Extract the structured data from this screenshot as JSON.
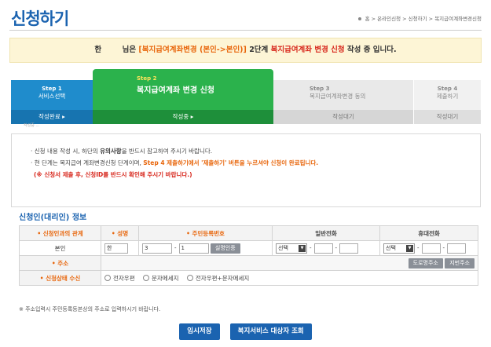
{
  "page": {
    "title": "신청하기",
    "breadcrumb": [
      "홈",
      "온라인신청",
      "신청하기",
      "복지급여계좌변경신청"
    ]
  },
  "notice": {
    "user": "한",
    "mid": "님은",
    "service": "[복지급여계좌변경 (본인->본인)]",
    "pre": "2단계",
    "step": "복지급여계좌 변경 신청",
    "post": "작성 중 입니다."
  },
  "steps": [
    {
      "no": "Step 1",
      "name": "서비스선택",
      "state": "작성완료 ▸"
    },
    {
      "no": "Step 2",
      "name": "복지급여계좌 변경 신청",
      "state": "작성중 ▸"
    },
    {
      "no": "Step 3",
      "name": "복지급여계좌변경 동의",
      "state": "작성대기"
    },
    {
      "no": "Step 4",
      "name": "제출하기",
      "state": "작성대기"
    }
  ],
  "step_sub": "작성중 ...",
  "info": {
    "line1_a": "· 신청 내용 작성 시, 하단의",
    "line1_b": "유의사항",
    "line1_c": "을 반드시 참고하여 주시기 바랍니다.",
    "line2_a": "· 현 단계는 복지급여 계좌변경신청 단계이며,",
    "line2_b": "Step 4 제출하기에서 '제출하기' 버튼을 누르셔야 신청이 완료됩니다.",
    "line3": "(※ 신청서 제출 후, 신청ID를 반드시 확인해 주시기 바랍니다.)"
  },
  "section_title": "신청인(대리인) 정보",
  "table": {
    "headers": {
      "relation": "신청인과의 관계",
      "name": "성명",
      "rrn": "주민등록번호",
      "phone": "일반전화",
      "mobile": "휴대전화"
    },
    "row": {
      "relation": "본인",
      "name": "한",
      "rrn_front": "3",
      "rrn_back": "1",
      "verify_button": "실명인증",
      "phone_select": "선택",
      "mobile_select": "선택"
    },
    "address_label": "주소",
    "road_address_button": "도로명주소",
    "lot_address_button": "지번주소",
    "status_label": "신청상태 수신",
    "status_options": [
      "전자우편",
      "문자메세지",
      "전자우편+문자메세지"
    ]
  },
  "footnote": "※ 주소입력시 주민등록등본상의 주소로 입력하시기 바랍니다.",
  "actions": {
    "save": "임시저장",
    "lookup": "복지서비스 대상자 조회"
  },
  "colors": {
    "brand_blue": "#1b63b0",
    "step_green": "#2bb24c",
    "step_blue": "#1f8ccc",
    "accent_orange": "#e8660c",
    "notice_bg": "#fdf5d6"
  }
}
